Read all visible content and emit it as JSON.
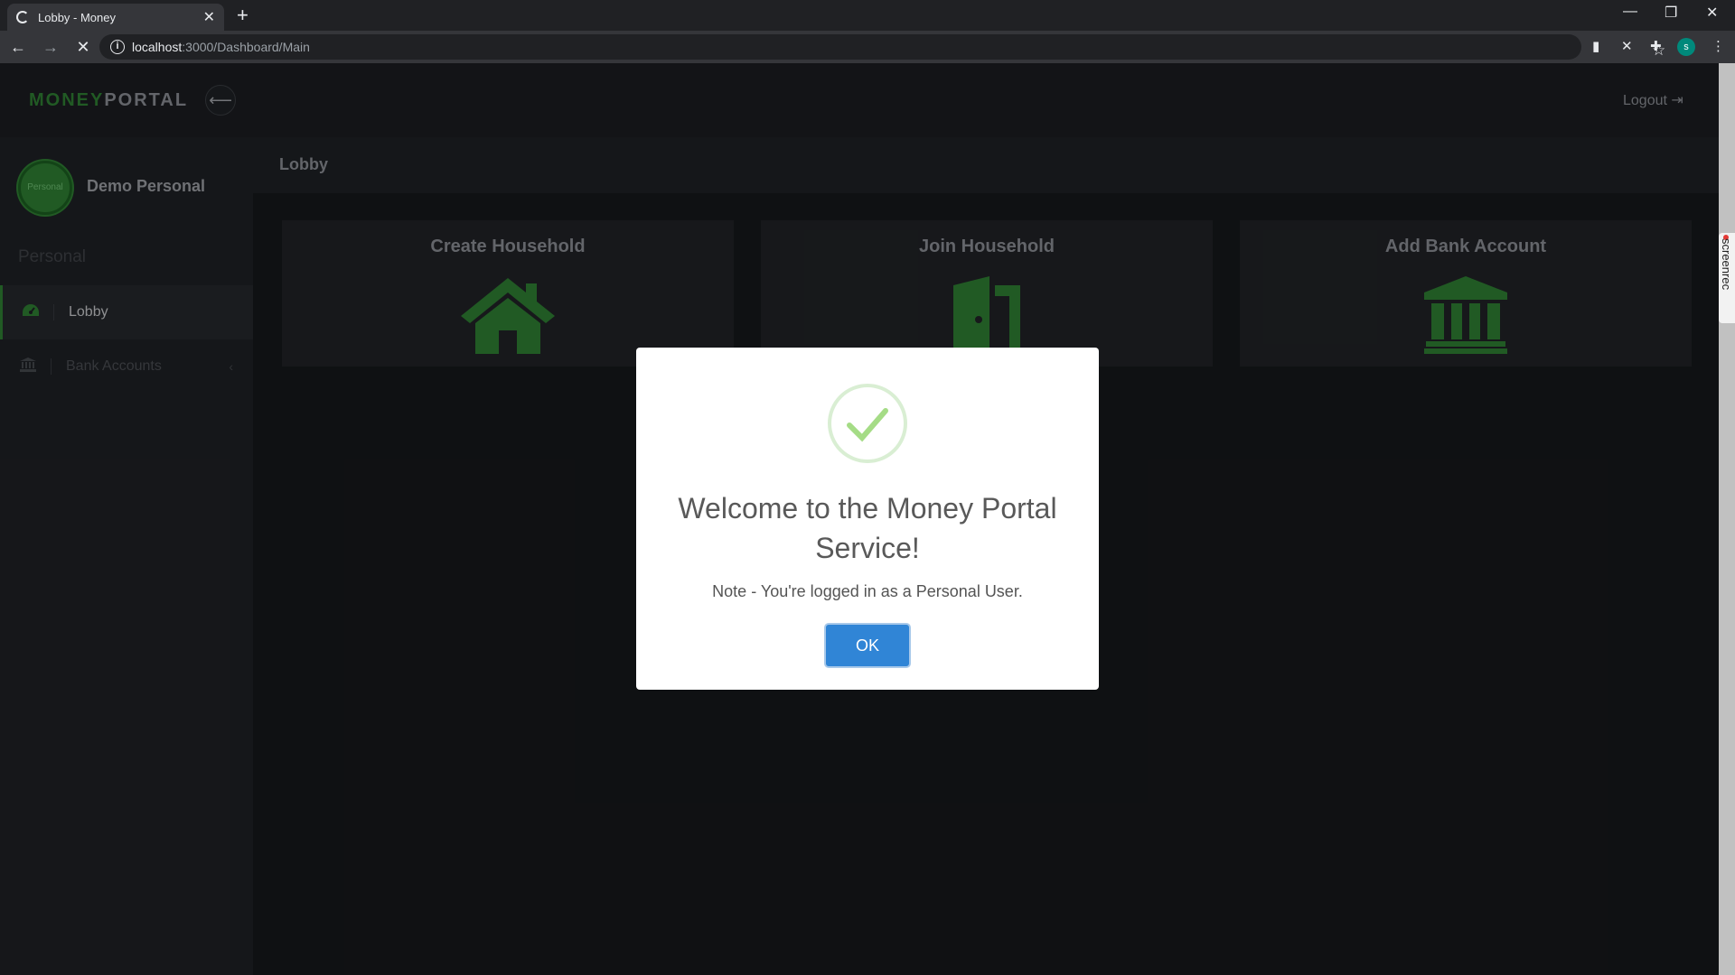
{
  "browser": {
    "tab_title": "Lobby - Money",
    "url_host": "localhost",
    "url_path": ":3000/Dashboard/Main",
    "profile_initial": "s"
  },
  "header": {
    "logo_part1": "MONEY",
    "logo_part2": "PORTAL",
    "logout_label": "Logout"
  },
  "sidebar": {
    "avatar_label": "Personal",
    "username": "Demo Personal",
    "section_label": "Personal",
    "items": [
      {
        "label": "Lobby",
        "icon": "dashboard-icon",
        "active": true
      },
      {
        "label": "Bank Accounts",
        "icon": "bank-icon",
        "active": false
      }
    ]
  },
  "main": {
    "page_title": "Lobby",
    "cards": [
      {
        "title": "Create Household",
        "icon": "house-icon"
      },
      {
        "title": "Join Household",
        "icon": "door-icon"
      },
      {
        "title": "Add Bank Account",
        "icon": "bank-icon"
      }
    ]
  },
  "modal": {
    "title": "Welcome to the Money Portal Service!",
    "note": "Note - You're logged in as a Personal User.",
    "ok_label": "OK"
  },
  "extension": {
    "label": "screenrec"
  },
  "colors": {
    "brand_green": "#2e7d32",
    "ok_blue": "#3085d6",
    "check_green": "#a5dc86"
  }
}
